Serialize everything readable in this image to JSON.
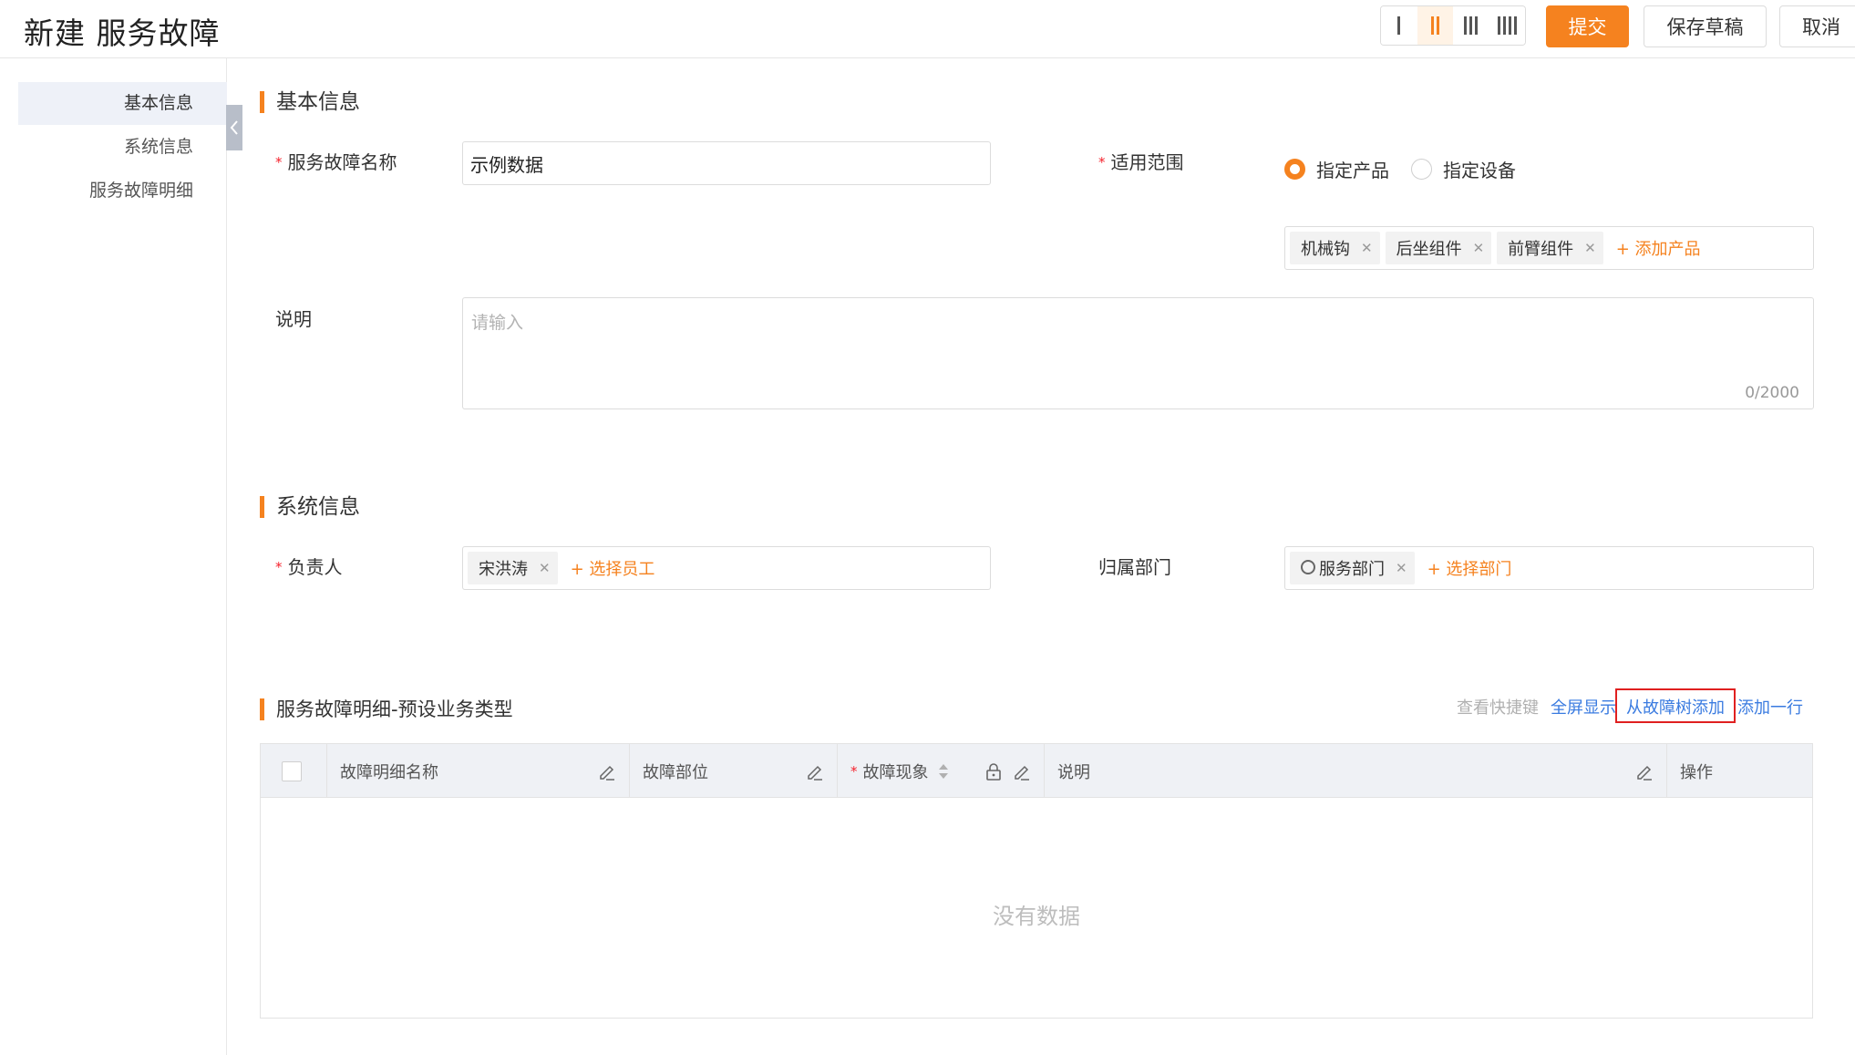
{
  "header": {
    "title": "新建 服务故障",
    "layout_options": [
      "single-column",
      "two-column",
      "three-column",
      "four-column"
    ],
    "active_layout": "two-column",
    "submit_label": "提交",
    "save_draft_label": "保存草稿",
    "cancel_label": "取消"
  },
  "sidebar": {
    "items": [
      {
        "label": "基本信息",
        "active": true
      },
      {
        "label": "系统信息",
        "active": false
      },
      {
        "label": "服务故障明细",
        "active": false
      }
    ]
  },
  "basic": {
    "section_title": "基本信息",
    "name_label": "服务故障名称",
    "name_value": "示例数据",
    "scope_label": "适用范围",
    "scope_options": [
      "指定产品",
      "指定设备"
    ],
    "scope_selected": "指定产品",
    "products": [
      "机械钩",
      "后坐组件",
      "前臂组件"
    ],
    "add_product_label": "+ 添加产品",
    "desc_label": "说明",
    "desc_placeholder": "请输入",
    "desc_counter": "0/2000"
  },
  "system": {
    "section_title": "系统信息",
    "owner_label": "负责人",
    "owner_tag": "宋洪涛",
    "select_staff_label": "+ 选择员工",
    "dept_label": "归属部门",
    "dept_tag": "服务部门",
    "select_dept_label": "+ 选择部门"
  },
  "detail": {
    "section_title": "服务故障明细-预设业务类型",
    "shortcuts_label": "查看快捷键",
    "fullscreen_label": "全屏显示",
    "add_from_tree_label": "从故障树添加",
    "add_row_label": "添加一行",
    "columns": [
      "故障明细名称",
      "故障部位",
      "故障现象",
      "说明",
      "操作"
    ],
    "empty_text": "没有数据"
  },
  "colors": {
    "accent": "#f5821f",
    "link": "#3a7be0",
    "required": "#f5222d",
    "highlight": "#e02020"
  }
}
